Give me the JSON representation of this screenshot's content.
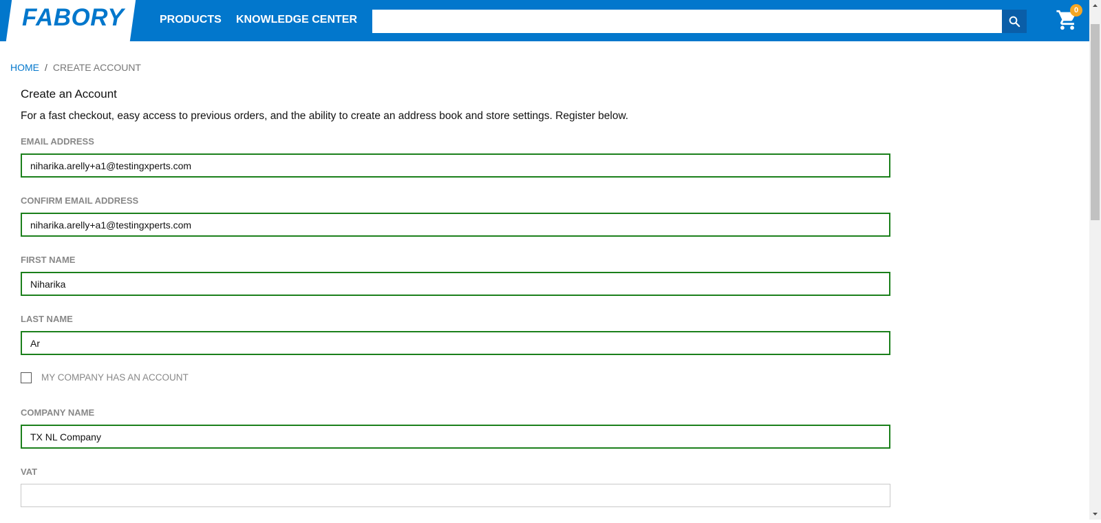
{
  "header": {
    "logo": "FABORY",
    "nav": [
      "PRODUCTS",
      "KNOWLEDGE CENTER"
    ],
    "search": {
      "placeholder": "",
      "value": ""
    },
    "cart_count": "0",
    "brand_color": "#0277cc"
  },
  "breadcrumb": {
    "home": "HOME",
    "separator": "/",
    "current": "CREATE ACCOUNT"
  },
  "form": {
    "title": "Create an Account",
    "intro": "For a fast checkout, easy access to previous orders, and the ability to create an address book and store settings. Register below.",
    "email_label": "EMAIL ADDRESS",
    "email_value": "niharika.arelly+a1@testingxperts.com",
    "confirm_email_label": "CONFIRM EMAIL ADDRESS",
    "confirm_email_value": "niharika.arelly+a1@testingxperts.com",
    "first_name_label": "FIRST NAME",
    "first_name_value": "Niharika",
    "last_name_label": "LAST NAME",
    "last_name_value": "Ar",
    "company_account_checkbox_label": "MY COMPANY HAS AN ACCOUNT",
    "company_account_checked": false,
    "company_name_label": "COMPANY NAME",
    "company_name_value": "TX NL Company",
    "vat_label": "VAT",
    "vat_value": "",
    "valid_border_color": "#1a7f1a"
  }
}
